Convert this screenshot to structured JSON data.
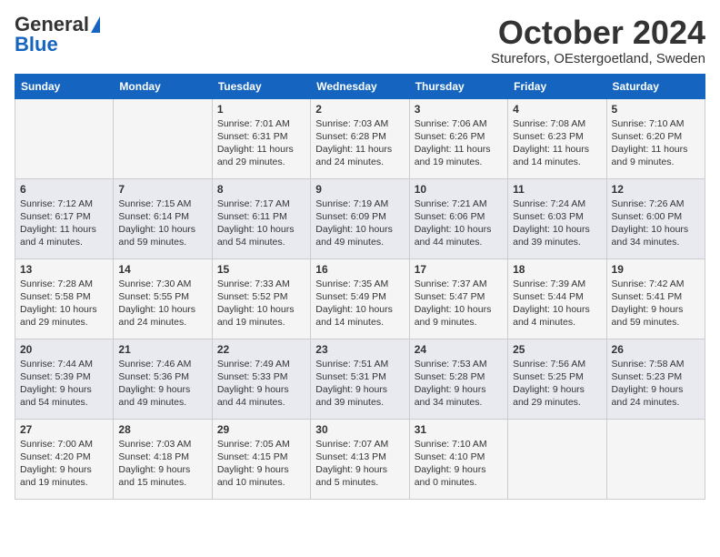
{
  "header": {
    "logo_general": "General",
    "logo_blue": "Blue",
    "month": "October 2024",
    "location": "Sturefors, OEstergoetland, Sweden"
  },
  "days_of_week": [
    "Sunday",
    "Monday",
    "Tuesday",
    "Wednesday",
    "Thursday",
    "Friday",
    "Saturday"
  ],
  "weeks": [
    [
      {
        "day": "",
        "content": ""
      },
      {
        "day": "",
        "content": ""
      },
      {
        "day": "1",
        "content": "Sunrise: 7:01 AM\nSunset: 6:31 PM\nDaylight: 11 hours and 29 minutes."
      },
      {
        "day": "2",
        "content": "Sunrise: 7:03 AM\nSunset: 6:28 PM\nDaylight: 11 hours and 24 minutes."
      },
      {
        "day": "3",
        "content": "Sunrise: 7:06 AM\nSunset: 6:26 PM\nDaylight: 11 hours and 19 minutes."
      },
      {
        "day": "4",
        "content": "Sunrise: 7:08 AM\nSunset: 6:23 PM\nDaylight: 11 hours and 14 minutes."
      },
      {
        "day": "5",
        "content": "Sunrise: 7:10 AM\nSunset: 6:20 PM\nDaylight: 11 hours and 9 minutes."
      }
    ],
    [
      {
        "day": "6",
        "content": "Sunrise: 7:12 AM\nSunset: 6:17 PM\nDaylight: 11 hours and 4 minutes."
      },
      {
        "day": "7",
        "content": "Sunrise: 7:15 AM\nSunset: 6:14 PM\nDaylight: 10 hours and 59 minutes."
      },
      {
        "day": "8",
        "content": "Sunrise: 7:17 AM\nSunset: 6:11 PM\nDaylight: 10 hours and 54 minutes."
      },
      {
        "day": "9",
        "content": "Sunrise: 7:19 AM\nSunset: 6:09 PM\nDaylight: 10 hours and 49 minutes."
      },
      {
        "day": "10",
        "content": "Sunrise: 7:21 AM\nSunset: 6:06 PM\nDaylight: 10 hours and 44 minutes."
      },
      {
        "day": "11",
        "content": "Sunrise: 7:24 AM\nSunset: 6:03 PM\nDaylight: 10 hours and 39 minutes."
      },
      {
        "day": "12",
        "content": "Sunrise: 7:26 AM\nSunset: 6:00 PM\nDaylight: 10 hours and 34 minutes."
      }
    ],
    [
      {
        "day": "13",
        "content": "Sunrise: 7:28 AM\nSunset: 5:58 PM\nDaylight: 10 hours and 29 minutes."
      },
      {
        "day": "14",
        "content": "Sunrise: 7:30 AM\nSunset: 5:55 PM\nDaylight: 10 hours and 24 minutes."
      },
      {
        "day": "15",
        "content": "Sunrise: 7:33 AM\nSunset: 5:52 PM\nDaylight: 10 hours and 19 minutes."
      },
      {
        "day": "16",
        "content": "Sunrise: 7:35 AM\nSunset: 5:49 PM\nDaylight: 10 hours and 14 minutes."
      },
      {
        "day": "17",
        "content": "Sunrise: 7:37 AM\nSunset: 5:47 PM\nDaylight: 10 hours and 9 minutes."
      },
      {
        "day": "18",
        "content": "Sunrise: 7:39 AM\nSunset: 5:44 PM\nDaylight: 10 hours and 4 minutes."
      },
      {
        "day": "19",
        "content": "Sunrise: 7:42 AM\nSunset: 5:41 PM\nDaylight: 9 hours and 59 minutes."
      }
    ],
    [
      {
        "day": "20",
        "content": "Sunrise: 7:44 AM\nSunset: 5:39 PM\nDaylight: 9 hours and 54 minutes."
      },
      {
        "day": "21",
        "content": "Sunrise: 7:46 AM\nSunset: 5:36 PM\nDaylight: 9 hours and 49 minutes."
      },
      {
        "day": "22",
        "content": "Sunrise: 7:49 AM\nSunset: 5:33 PM\nDaylight: 9 hours and 44 minutes."
      },
      {
        "day": "23",
        "content": "Sunrise: 7:51 AM\nSunset: 5:31 PM\nDaylight: 9 hours and 39 minutes."
      },
      {
        "day": "24",
        "content": "Sunrise: 7:53 AM\nSunset: 5:28 PM\nDaylight: 9 hours and 34 minutes."
      },
      {
        "day": "25",
        "content": "Sunrise: 7:56 AM\nSunset: 5:25 PM\nDaylight: 9 hours and 29 minutes."
      },
      {
        "day": "26",
        "content": "Sunrise: 7:58 AM\nSunset: 5:23 PM\nDaylight: 9 hours and 24 minutes."
      }
    ],
    [
      {
        "day": "27",
        "content": "Sunrise: 7:00 AM\nSunset: 4:20 PM\nDaylight: 9 hours and 19 minutes."
      },
      {
        "day": "28",
        "content": "Sunrise: 7:03 AM\nSunset: 4:18 PM\nDaylight: 9 hours and 15 minutes."
      },
      {
        "day": "29",
        "content": "Sunrise: 7:05 AM\nSunset: 4:15 PM\nDaylight: 9 hours and 10 minutes."
      },
      {
        "day": "30",
        "content": "Sunrise: 7:07 AM\nSunset: 4:13 PM\nDaylight: 9 hours and 5 minutes."
      },
      {
        "day": "31",
        "content": "Sunrise: 7:10 AM\nSunset: 4:10 PM\nDaylight: 9 hours and 0 minutes."
      },
      {
        "day": "",
        "content": ""
      },
      {
        "day": "",
        "content": ""
      }
    ]
  ]
}
